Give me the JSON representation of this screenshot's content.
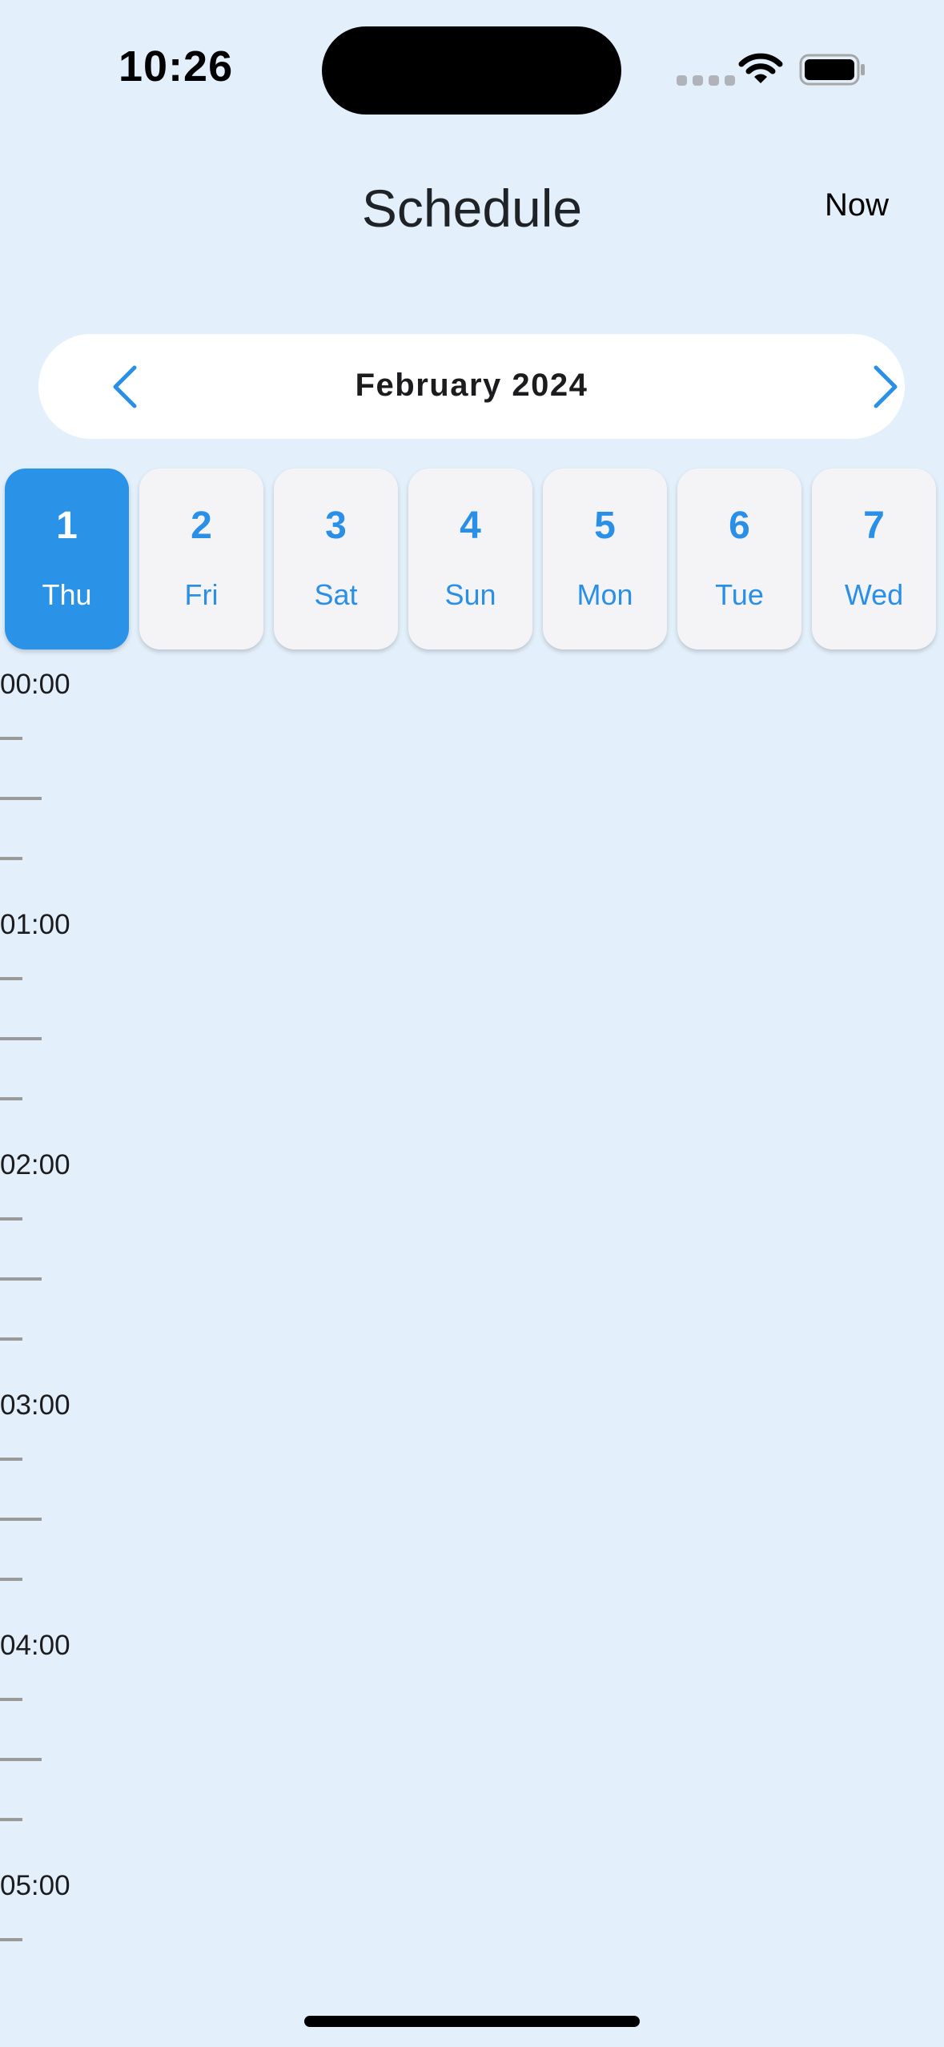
{
  "status_bar": {
    "time": "10:26"
  },
  "header": {
    "title": "Schedule",
    "now_label": "Now"
  },
  "month_nav": {
    "label": "February 2024"
  },
  "days": [
    {
      "num": "1",
      "weekday": "Thu",
      "selected": true
    },
    {
      "num": "2",
      "weekday": "Fri",
      "selected": false
    },
    {
      "num": "3",
      "weekday": "Sat",
      "selected": false
    },
    {
      "num": "4",
      "weekday": "Sun",
      "selected": false
    },
    {
      "num": "5",
      "weekday": "Mon",
      "selected": false
    },
    {
      "num": "6",
      "weekday": "Tue",
      "selected": false
    },
    {
      "num": "7",
      "weekday": "Wed",
      "selected": false
    }
  ],
  "timeline": {
    "hours": [
      "00:00",
      "01:00",
      "02:00",
      "03:00",
      "04:00",
      "05:00"
    ]
  },
  "colors": {
    "accent": "#2a93e8",
    "background": "#e3f0fb"
  }
}
